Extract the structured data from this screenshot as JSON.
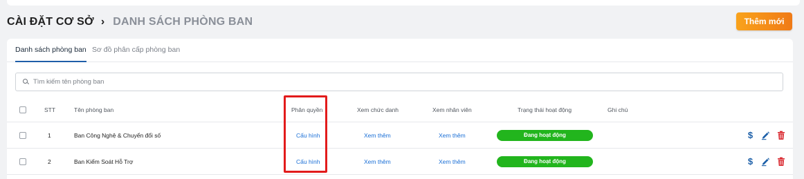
{
  "breadcrumb": {
    "root": "CÀI ĐẶT CƠ SỞ",
    "separator": "›",
    "current": "DANH SÁCH PHÒNG BAN"
  },
  "add_button": {
    "label": "Thêm mới"
  },
  "tabs": [
    {
      "label": "Danh sách phòng ban",
      "active": true
    },
    {
      "label": "Sơ đồ phân cấp phòng ban",
      "active": false
    }
  ],
  "search": {
    "placeholder": "Tìm kiếm tên phòng ban",
    "value": ""
  },
  "table": {
    "columns": {
      "stt": "STT",
      "name": "Tên phòng ban",
      "permission": "Phân quyền",
      "job_titles": "Xem chức danh",
      "employees": "Xem nhân viên",
      "status": "Trạng thái hoạt động",
      "note": "Ghi chú"
    },
    "rows": [
      {
        "stt": "1",
        "name": "Ban Công Nghệ & Chuyển đổi số",
        "permission": "Cấu hình",
        "job_titles": "Xem thêm",
        "employees": "Xem thêm",
        "status": "Đang hoạt động",
        "note": ""
      },
      {
        "stt": "2",
        "name": "Ban Kiểm Soát Hỗ Trợ",
        "permission": "Cấu hình",
        "job_titles": "Xem thêm",
        "employees": "Xem thêm",
        "status": "Đang hoạt động",
        "note": ""
      }
    ]
  },
  "icons": {
    "billing": "dollar-icon",
    "edit": "pencil-icon",
    "delete": "trash-icon"
  },
  "colors": {
    "accent": "#1f5ea8",
    "link": "#1a6fd6",
    "status_active": "#22b51d",
    "delete": "#d9282f",
    "button_gradient_start": "#f9a31c",
    "button_gradient_end": "#f07a16",
    "highlight_border": "#e21b1b"
  }
}
